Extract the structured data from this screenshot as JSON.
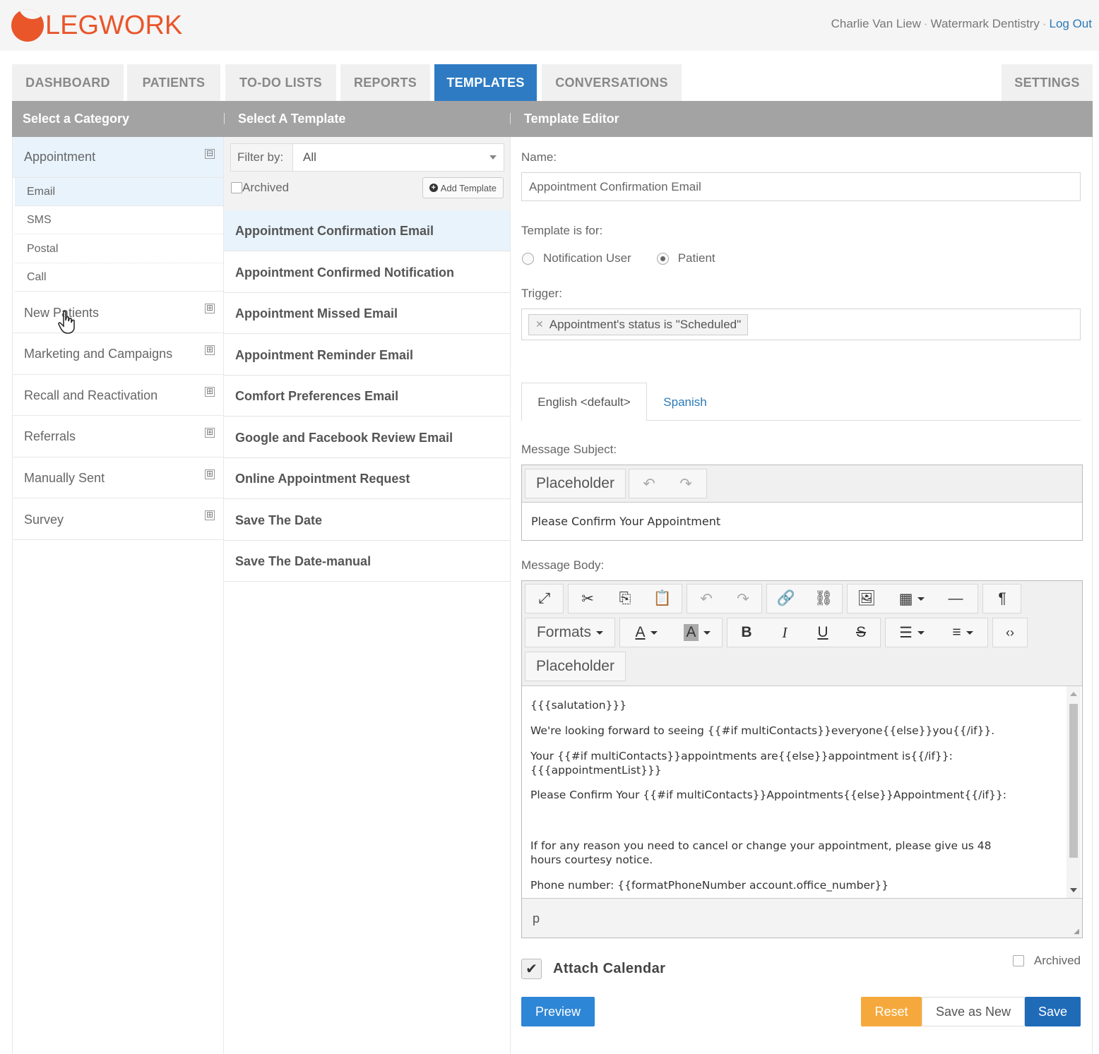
{
  "app": {
    "brand": "LEGWORK",
    "user": "Charlie Van Liew",
    "practice": "Watermark Dentistry",
    "logout": "Log Out"
  },
  "nav": {
    "tabs": [
      "DASHBOARD",
      "PATIENTS",
      "TO-DO LISTS",
      "REPORTS",
      "TEMPLATES",
      "CONVERSATIONS"
    ],
    "active": "TEMPLATES",
    "settings": "SETTINGS"
  },
  "bar": {
    "col1": "Select a Category",
    "col2": "Select A Template",
    "col3": "Template Editor"
  },
  "categories": {
    "appointment": {
      "label": "Appointment",
      "expander": "⊟",
      "subs": [
        "Email",
        "SMS",
        "Postal",
        "Call"
      ]
    },
    "others": [
      "New Patients",
      "Marketing and Campaigns",
      "Recall and Reactivation",
      "Referrals",
      "Manually Sent",
      "Survey"
    ],
    "expander": "⊞"
  },
  "templates": {
    "filter_label": "Filter by:",
    "filter_value": "All",
    "archived_label": "Archived",
    "add_label": "Add Template",
    "items": [
      "Appointment Confirmation Email",
      "Appointment Confirmed Notification",
      "Appointment Missed Email",
      "Appointment Reminder Email",
      "Comfort Preferences Email",
      "Google and Facebook Review Email",
      "Online Appointment Request",
      "Save The Date",
      "Save The Date-manual"
    ]
  },
  "editor": {
    "name_label": "Name:",
    "name_value": "Appointment Confirmation Email",
    "for_label": "Template is for:",
    "for_options": [
      "Notification User",
      "Patient"
    ],
    "for_selected": "Patient",
    "trigger_label": "Trigger:",
    "trigger_tag": "Appointment's status is \"Scheduled\"",
    "lang_tabs": [
      "English <default>",
      "Spanish"
    ],
    "subject_label": "Message Subject:",
    "placeholder_btn": "Placeholder",
    "subject_value": "Please Confirm Your Appointment",
    "body_label": "Message Body:",
    "formats_label": "Formats",
    "body_lines": [
      "{{{salutation}}}",
      "We're looking forward to seeing {{#if multiContacts}}everyone{{else}}you{{/if}}.",
      "Your {{#if multiContacts}}appointments are{{else}}appointment is{{/if}}:",
      "{{{appointmentList}}}",
      "Please Confirm Your {{#if multiContacts}}Appointments{{else}}Appointment{{/if}}:",
      "If for any reason you need to cancel or change your appointment, please give us 48",
      "hours courtesy notice.",
      "Phone number: {{formatPhoneNumber account.office_number}}"
    ],
    "status_path": "p",
    "attach_calendar": "Attach Calendar",
    "attach_checked": true,
    "archived_label": "Archived",
    "preview_btn": "Preview",
    "reset_btn": "Reset",
    "save_new_btn": "Save as New",
    "save_btn": "Save"
  },
  "colors": {
    "brand": "#e8562a",
    "active_tab": "#2e7bc4",
    "header_bar": "#a3a3a3",
    "selection": "#e8f3fc",
    "link": "#2a7ab8",
    "reset": "#f5a93c",
    "save": "#1f6bb8"
  }
}
